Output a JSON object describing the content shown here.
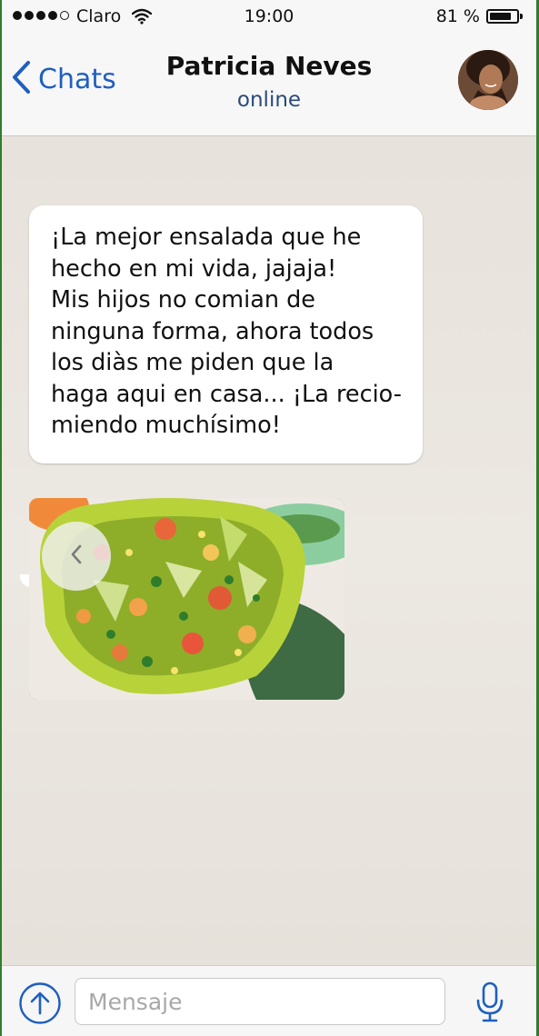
{
  "status_bar": {
    "carrier": "Claro",
    "time": "19:00",
    "battery_percent": "81 %",
    "battery_level": 0.81,
    "signal_bars_filled": 4,
    "signal_bars_total": 5
  },
  "header": {
    "back_label": "Chats",
    "contact_name": "Patricia Neves",
    "contact_status": "online"
  },
  "messages": [
    {
      "type": "text",
      "lines": [
        "¡La mejor ensalada que he",
        "hecho en mi vida, jajaja!",
        "Mis hijos no comian de",
        "ninguna forma, ahora todos",
        "los diàs me piden que la",
        "haga aqui en casa... ¡La recio-",
        "miendo muchísimo!"
      ]
    },
    {
      "type": "image",
      "subject": "salad-in-green-bowl"
    }
  ],
  "composer": {
    "placeholder": "Mensaje"
  },
  "colors": {
    "accent": "#1f5fbf",
    "frame": "#2f7d2b",
    "bubble": "#ffffff",
    "chat_background": "#e9e5de"
  },
  "icons": {
    "back": "chevron-left-icon",
    "wifi": "wifi-icon",
    "battery": "battery-icon",
    "gallery_prev": "chevron-left-icon",
    "attach": "arrow-up-circle-icon",
    "mic": "microphone-icon"
  }
}
